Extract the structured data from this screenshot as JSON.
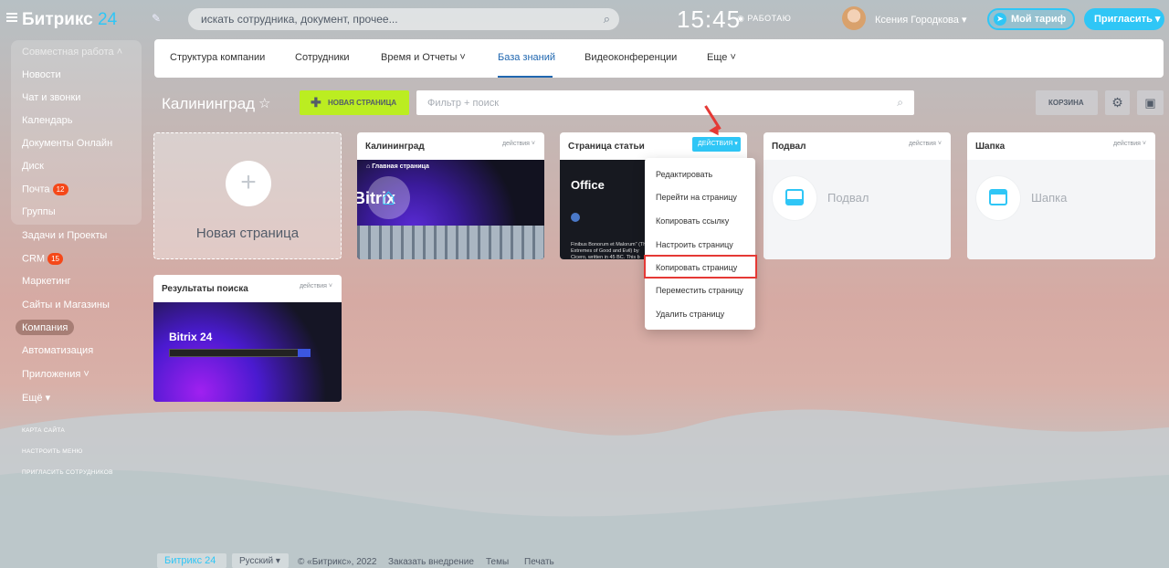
{
  "header": {
    "logo": "Битрикс",
    "logo_num": "24",
    "search_placeholder": "искать сотрудника, документ, прочее...",
    "clock": "15:45",
    "status": "РАБОТАЮ",
    "user_name": "Ксения Городкова",
    "tariff_label": "Мой тариф",
    "invite_label": "Пригласить"
  },
  "sidebar": {
    "group_head": "Совместная работа",
    "items": [
      {
        "label": "Новости"
      },
      {
        "label": "Чат и звонки"
      },
      {
        "label": "Календарь"
      },
      {
        "label": "Документы Онлайн"
      },
      {
        "label": "Диск"
      },
      {
        "label": "Почта",
        "badge": "12"
      },
      {
        "label": "Группы"
      },
      {
        "label": "Задачи и Проекты"
      },
      {
        "label": "CRM",
        "badge": "15"
      },
      {
        "label": "Маркетинг"
      },
      {
        "label": "Сайты и Магазины"
      },
      {
        "label": "Компания"
      },
      {
        "label": "Автоматизация"
      },
      {
        "label": "Приложения"
      },
      {
        "label": "Ещё"
      }
    ],
    "site_map": "КАРТА САЙТА",
    "configure_menu": "НАСТРОИТЬ МЕНЮ",
    "invite_staff": "ПРИГЛАСИТЬ СОТРУДНИКОВ"
  },
  "tabs": {
    "structure": "Структура компании",
    "employees": "Сотрудники",
    "time": "Время и Отчеты",
    "knowledge": "База знаний",
    "video": "Видеоконференции",
    "more": "Еще"
  },
  "toolbar": {
    "title": "Калининград",
    "new_page": "НОВАЯ СТРАНИЦА",
    "filter_placeholder": "Фильтр + поиск",
    "trash": "КОРЗИНА"
  },
  "cards": {
    "new_page_label": "Новая страница",
    "kaliningrad": {
      "title": "Калининград",
      "actions": "действия",
      "preview_nav": "Главная страница",
      "preview_text": "Bitrix"
    },
    "article": {
      "title": "Страница статьи",
      "actions": "ДЕЙСТВИЯ",
      "preview_head": "Office",
      "preview_body": "Finibus Bonorum et Malorum\" (The Extremes of Good and Evil) by Cicero, written in 45 BC. This b"
    },
    "footer_card": {
      "title": "Подвал",
      "actions": "действия",
      "label": "Подвал"
    },
    "header_card": {
      "title": "Шапка",
      "actions": "действия",
      "label": "Шапка"
    },
    "search_results": {
      "title": "Результаты поиска",
      "actions": "действия",
      "preview_text": "Bitrix 24"
    }
  },
  "dropdown": {
    "items": [
      "Редактировать",
      "Перейти на страницу",
      "Копировать ссылку",
      "Настроить страницу",
      "Копировать страницу",
      "Переместить страницу",
      "Удалить страницу"
    ]
  },
  "footer": {
    "logo": "Битрикс 24",
    "lang": "Русский",
    "copyright": "© «Битрикс», 2022",
    "order": "Заказать внедрение",
    "themes": "Темы",
    "print": "Печать"
  },
  "colors": {
    "accent": "#2fc6f6",
    "green_button": "#bbed21",
    "highlight": "#e53935",
    "badge": "#f54819"
  }
}
